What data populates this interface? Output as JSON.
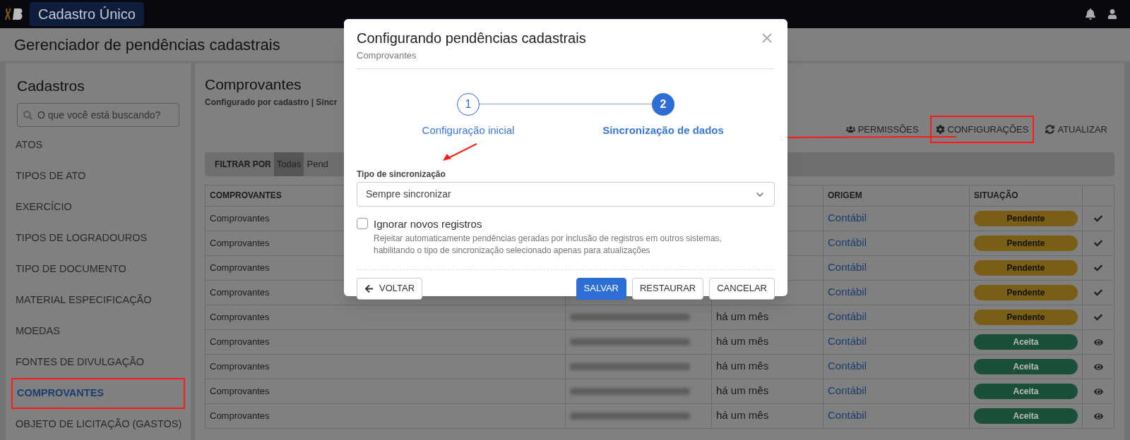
{
  "topbar": {
    "app_name": "Cadastro Único"
  },
  "page_title": "Gerenciador de pendências cadastrais",
  "sidebar": {
    "title": "Cadastros",
    "search": {
      "placeholder": "O que você está buscando?"
    },
    "items": [
      {
        "label": "ATOS",
        "selected": false,
        "highlighted": false
      },
      {
        "label": "TIPOS DE ATO",
        "selected": false,
        "highlighted": false
      },
      {
        "label": "EXERCÍCIO",
        "selected": false,
        "highlighted": false
      },
      {
        "label": "TIPOS DE LOGRADOUROS",
        "selected": false,
        "highlighted": false
      },
      {
        "label": "TIPO DE DOCUMENTO",
        "selected": false,
        "highlighted": false
      },
      {
        "label": "MATERIAL ESPECIFICAÇÃO",
        "selected": false,
        "highlighted": false
      },
      {
        "label": "MOEDAS",
        "selected": false,
        "highlighted": false
      },
      {
        "label": "FONTES DE DIVULGAÇÃO",
        "selected": false,
        "highlighted": false
      },
      {
        "label": "COMPROVANTES",
        "selected": true,
        "highlighted": true
      },
      {
        "label": "OBJETO DE LICITAÇÃO (GASTOS)",
        "selected": false,
        "highlighted": false
      }
    ]
  },
  "main": {
    "title": "Comprovantes",
    "subtitle": "Configurado por cadastro | Sincr",
    "toolbar": [
      {
        "kind": "users",
        "label": "PERMISSÕES",
        "highlighted": false
      },
      {
        "kind": "gear",
        "label": "CONFIGURAÇÕES",
        "highlighted": true
      },
      {
        "kind": "refresh",
        "label": "ATUALIZAR",
        "highlighted": false
      }
    ],
    "filter": {
      "label": "FILTRAR POR",
      "options": [
        {
          "label": "Todas",
          "selected": true
        },
        {
          "label": "Pend",
          "selected": false
        }
      ]
    },
    "table": {
      "columns": [
        "COMPROVANTES",
        "",
        "",
        "ORIGEM",
        "SITUAÇÃO",
        ""
      ],
      "rows": [
        {
          "kind": "pending",
          "name": "Comprovantes",
          "origin": "Contábil",
          "status": "Pendente",
          "color": "#7a5e16"
        },
        {
          "kind": "pending",
          "name": "Comprovantes",
          "origin": "Contábil",
          "status": "Pendente",
          "color": "#7a5e16"
        },
        {
          "kind": "pending",
          "name": "Comprovantes",
          "origin": "Contábil",
          "status": "Pendente",
          "color": "#7a5e16"
        },
        {
          "kind": "pending",
          "name": "Comprovantes",
          "origin": "Contábil",
          "status": "Pendente",
          "color": "#7a5e16"
        },
        {
          "kind": "pending",
          "name": "Comprovantes",
          "blurred": true,
          "date": "há um mês",
          "origin": "Contábil",
          "status": "Pendente",
          "color": "#7a5e16"
        },
        {
          "kind": "accepted",
          "name": "Comprovantes",
          "blurred": true,
          "date": "há um mês",
          "origin": "Contábil",
          "status": "Aceita",
          "color": "#1a503a"
        },
        {
          "kind": "accepted",
          "name": "Comprovantes",
          "blurred": true,
          "date": "há um mês",
          "origin": "Contábil",
          "status": "Aceita",
          "color": "#1a503a"
        },
        {
          "kind": "accepted",
          "name": "Comprovantes",
          "blurred": true,
          "date": "há um mês",
          "origin": "Contábil",
          "status": "Aceita",
          "color": "#1a503a"
        },
        {
          "kind": "accepted",
          "name": "Comprovantes",
          "blurred": true,
          "date": "há um mês",
          "origin": "Contábil",
          "status": "Aceita",
          "color": "#1a503a"
        }
      ]
    }
  },
  "modal": {
    "title": "Configurando pendências cadastrais",
    "subtitle": "Comprovantes",
    "steps": [
      {
        "number": "1",
        "label": "Configuração inicial",
        "selected": false
      },
      {
        "number": "2",
        "label": "Sincronização de dados",
        "selected": true
      }
    ],
    "field": {
      "label": "Tipo de sincronização",
      "value": "Sempre sincronizar"
    },
    "checkbox": {
      "label": "Ignorar novos registros",
      "checked": false,
      "description": "Rejeitar automaticamente pendências geradas por inclusão de registros em outros sistemas, habilitando o tipo de sincronização selecionado apenas para atualizações"
    },
    "buttons": [
      {
        "kind": "back",
        "label": "VOLTAR"
      },
      {
        "kind": "primary",
        "label": "SALVAR"
      },
      {
        "kind": "default",
        "label": "RESTAURAR"
      },
      {
        "kind": "default",
        "label": "CANCELAR"
      }
    ]
  }
}
